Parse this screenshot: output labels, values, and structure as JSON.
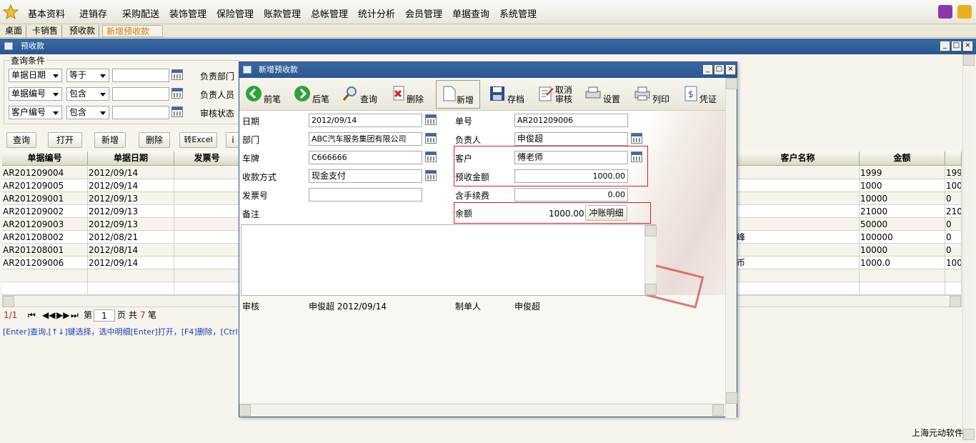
{
  "menu": {
    "items": [
      "基本资料",
      "进销存",
      "采购配送",
      "装饰管理",
      "保险管理",
      "账款管理",
      "总帐管理",
      "统计分析",
      "会员管理",
      "单据查询",
      "系统管理"
    ]
  },
  "tabs": [
    "桌面",
    "卡销售",
    "预收款",
    "新增预收款"
  ],
  "main_window": {
    "title": "预收款"
  },
  "query": {
    "group_title": "查询条件",
    "rows": [
      {
        "field": "单据日期",
        "op": "等于",
        "value": ""
      },
      {
        "field": "单据编号",
        "op": "包含",
        "value": ""
      },
      {
        "field": "客户编号",
        "op": "包含",
        "value": ""
      }
    ],
    "side_labels": [
      "负责部门",
      "负责人员",
      "审核状态"
    ]
  },
  "actions": [
    "查询",
    "打开",
    "新增",
    "删除",
    "转Excel",
    "i"
  ],
  "grid": {
    "left_headers": [
      "单据编号",
      "单据日期",
      "发票号"
    ],
    "right_headers": [
      "客户名称",
      "金额"
    ],
    "rows": [
      {
        "no": "AR201209004",
        "date": "2012/09/14",
        "cust": "",
        "amount": "1999",
        "extra": "199"
      },
      {
        "no": "AR201209005",
        "date": "2012/09/14",
        "cust": "",
        "amount": "1000",
        "extra": "100"
      },
      {
        "no": "AR201209001",
        "date": "2012/09/13",
        "cust": "",
        "amount": "10000",
        "extra": "0"
      },
      {
        "no": "AR201209002",
        "date": "2012/09/13",
        "cust": "",
        "amount": "21000",
        "extra": "210"
      },
      {
        "no": "AR201209003",
        "date": "2012/09/13",
        "cust": "",
        "amount": "50000",
        "extra": "0"
      },
      {
        "no": "AR201208002",
        "date": "2012/08/21",
        "cust": "峰",
        "amount": "100000",
        "extra": "0"
      },
      {
        "no": "AR201208001",
        "date": "2012/08/14",
        "cust": "",
        "amount": "10000",
        "extra": "0"
      },
      {
        "no": "AR201209006",
        "date": "2012/09/14",
        "cust": "币",
        "amount": "1000.0",
        "extra": "100"
      }
    ]
  },
  "pager": {
    "pos": "1/1",
    "page_label": "第",
    "page": "1",
    "page_unit": "页",
    "total_label": "共",
    "total": "7",
    "total_unit": "笔"
  },
  "hint": "[Enter]查询,[↑↓]键选择，选中明细[Enter]打开，[F4]删除，[Ctrl+N]新增",
  "footer": "上海元动软件",
  "dialog": {
    "title": "新增预收款",
    "toolbar": [
      "前笔",
      "后笔",
      "查询",
      "删除",
      "新增",
      "存档",
      "取消",
      "审核",
      "设置",
      "列印",
      "凭证"
    ],
    "labels": {
      "date": "日期",
      "dept": "部门",
      "plate": "车牌",
      "pay": "收款方式",
      "invoice": "发票号",
      "memo": "备注",
      "no": "单号",
      "owner": "负责人",
      "customer": "客户",
      "pre_amount": "预收金额",
      "fee": "含手续费",
      "balance": "余额",
      "auditor": "审核",
      "maker": "制单人"
    },
    "values": {
      "date": "2012/09/14",
      "dept": "ABC汽车服务集团有限公司",
      "plate": "C666666",
      "pay": "现金支付",
      "invoice": "",
      "no": "AR201209006",
      "owner": "申俊超",
      "customer": "傅老师",
      "pre_amount": "1000.00",
      "fee": "0.00",
      "balance": "1000.00",
      "auditor": "申俊超 2012/09/14",
      "maker": "申俊超"
    },
    "detail_button": "冲账明细"
  }
}
